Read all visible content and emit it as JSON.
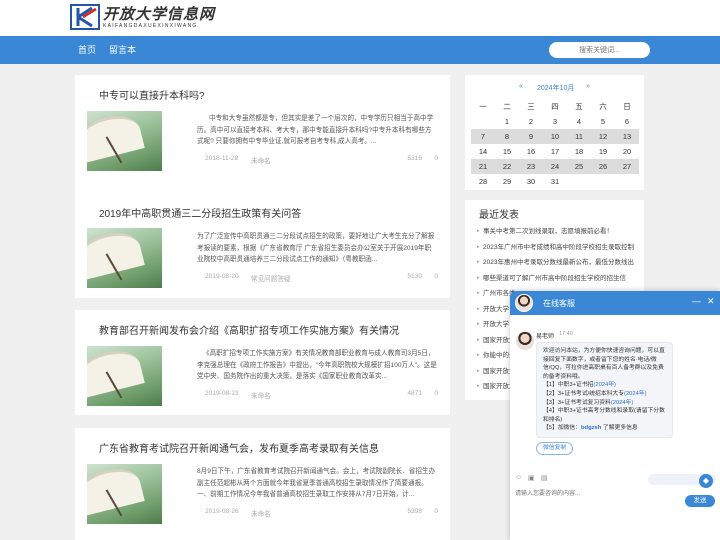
{
  "site": {
    "logo_cn": "开放大学信息网",
    "logo_en": "KAIFANGDAXUEXINXIWANG"
  },
  "nav": {
    "items": [
      "首页",
      "留言本"
    ],
    "search_placeholder": "搜索关键词..."
  },
  "articles": [
    {
      "title": "中专可以直接升本科吗?",
      "excerpt": "中专和大专虽然都是专，但其实是差了一个层次的，中专学历只相当于高中学历。高中可以直接考本科、考大专，那中专能直接升本科吗?中专升本科有哪些方式呢?     只要你拥有中专毕业证,就可报考自考专科,成人高考。...",
      "date": "2018-11-28",
      "author": "未命名",
      "views": "5316",
      "comments": "0"
    },
    {
      "title": "2019年中高职贯通三二分段招生政策有关问答",
      "excerpt": "为了广泛宣传中高职贯通三二分段试点招生的政策，要好地让广大考生充分了解报考报读的要素，根据《广东省教育厅 广东省招生委员会办公室关于开展2019年职业院校中高职贯通培养三二分段试点工作的通知》（粤教职函...",
      "date": "2019-08-20",
      "author": "常见问题答疑",
      "views": "5130",
      "comments": "0"
    },
    {
      "title": "教育部召开新闻发布会介绍《高职扩招专项工作实施方案》有关情况",
      "excerpt": "《高职扩招专项工作实施方案》有关情况教育部职业教育与成人教育司3月5日，李克强总理在《政府工作报告》中提出，\"今年高职院校大规模扩招100万人\"。这是党中央、国务院作出的重大决策，是落实《国家职业教育改革实...",
      "date": "2019-08-23",
      "author": "未命名",
      "views": "4871",
      "comments": "0"
    },
    {
      "title": "广东省教育考试院召开新闻通气会，发布夏季高考录取有关信息",
      "excerpt": "8月9日下午，广东省教育考试院召开新闻通气会。会上，考试院副院长、省招生办副主任范超彬从两个方面就今年我省夏季普通高校招生录取情况作了简要通报。一、前期工作情况今年我省普通高校招生录取工作安排从7月7日开始，计...",
      "date": "2019-08-26",
      "author": "未命名",
      "views": "5398",
      "comments": "0"
    }
  ],
  "calendar": {
    "prev": "«",
    "next": "»",
    "month_label": "2024年10月",
    "weekdays": [
      "一",
      "二",
      "三",
      "四",
      "五",
      "六",
      "日"
    ],
    "rows": [
      [
        "",
        "1",
        "2",
        "3",
        "4",
        "5",
        "6"
      ],
      [
        "7",
        "8",
        "9",
        "10",
        "11",
        "12",
        "13"
      ],
      [
        "14",
        "15",
        "16",
        "17",
        "18",
        "19",
        "20"
      ],
      [
        "21",
        "22",
        "23",
        "24",
        "25",
        "26",
        "27"
      ],
      [
        "28",
        "29",
        "30",
        "31",
        "",
        "",
        ""
      ]
    ]
  },
  "latest": {
    "title": "最近发表",
    "items": [
      "事关中考第二次划线录取，志愿填报前必看！",
      "2023年广州市中考成绩和高中阶段学校招生录取控制",
      "2023年惠州中考录取分数线最新公布，最低分数线出",
      "哪些渠道可了解广州市高中阶段招生学校的招生信",
      "广州市各类",
      "开放大学",
      "开放大学",
      "国家开放大",
      "你能中的云",
      "国家开放大",
      "国家开放大学"
    ]
  },
  "chat": {
    "title": "在线客服",
    "minimize": "—",
    "close": "✕",
    "sender": "易老师",
    "time": "17:40",
    "lines": [
      "欢迎访问本站，为方便你快速咨询问题，可以直接回复下面数字，或者留下您的姓名·电话/微信/QQ，可拉你进高职桌有百人备考群以及免费的备考资料哦。",
      "【1】中职3+证书招",
      "(2024年)",
      "【2】3+证书考试/统招本科大专",
      "(2024年)",
      "【3】3+证书考试复习资料",
      "(2024年)",
      "【4】中职3+证书高考分数线和录取(请留下分数和排名)",
      "【5】加微信：",
      "bdgzsh",
      " 了解更多信息"
    ],
    "wechat_button": "微信复制",
    "input_placeholder": "请输入您要咨询的内容...",
    "send": "发送",
    "tool_icons": [
      "emoji-icon",
      "image-icon",
      "file-icon"
    ]
  }
}
